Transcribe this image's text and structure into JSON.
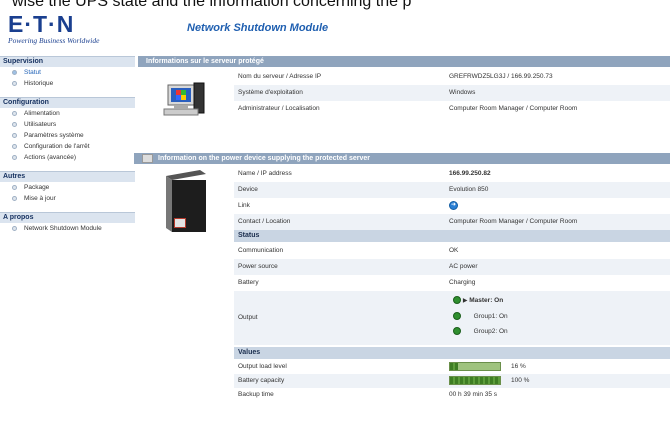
{
  "caption_top": "wise the UPS state and the information concerning the p",
  "brand": {
    "logo": "E·T·N",
    "tagline": "Powering Business Worldwide",
    "app_title": "Network Shutdown Module"
  },
  "sidebar": {
    "sections": [
      {
        "title": "Supervision",
        "items": [
          "Statut",
          "Historique"
        ]
      },
      {
        "title": "Configuration",
        "items": [
          "Alimentation",
          "Utilisateurs",
          "Paramètres système",
          "Configuration de l'arrêt",
          "Actions (avancée)"
        ]
      },
      {
        "title": "Autres",
        "items": [
          "Package",
          "Mise à jour"
        ]
      },
      {
        "title": "A propos",
        "items": [
          "Network Shutdown Module"
        ]
      }
    ]
  },
  "server_panel": {
    "title": "Informations sur le serveur protégé",
    "rows": [
      {
        "label": "Nom du serveur / Adresse IP",
        "value": "GREFRWDZ5LG3J / 166.99.250.73"
      },
      {
        "label": "Système d'exploitation",
        "value": "Windows"
      },
      {
        "label": "Administrateur / Localisation",
        "value": "Computer Room Manager / Computer Room"
      }
    ]
  },
  "power_panel": {
    "title": "Information on the power device supplying the protected server",
    "rows": [
      {
        "label": "Name / IP address",
        "value": "166.99.250.82"
      },
      {
        "label": "Device",
        "value": "Evolution 850"
      },
      {
        "label": "Link",
        "value": ""
      },
      {
        "label": "Contact / Location",
        "value": "Computer Room Manager / Computer Room"
      }
    ],
    "status_title": "Status",
    "status_rows": [
      {
        "label": "Communication",
        "value": "OK"
      },
      {
        "label": "Power source",
        "value": "AC power"
      },
      {
        "label": "Battery",
        "value": "Charging"
      }
    ],
    "output": {
      "label": "Output",
      "master": "Master: On",
      "group1": "Group1: On",
      "group2": "Group2: On"
    },
    "values_title": "Values",
    "values_rows": [
      {
        "label": "Output load level",
        "value": "16 %",
        "level": 0.16
      },
      {
        "label": "Battery capacity",
        "value": "100 %",
        "level": 1.0
      },
      {
        "label": "Backup time",
        "value": "00 h 39 min 35 s"
      }
    ]
  }
}
